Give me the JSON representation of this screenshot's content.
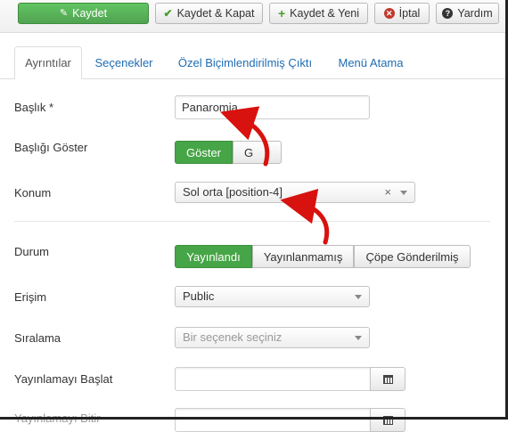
{
  "toolbar": {
    "save": "Kaydet",
    "save_close": "Kaydet & Kapat",
    "save_new": "Kaydet & Yeni",
    "cancel": "İptal",
    "help": "Yardım"
  },
  "tabs": [
    {
      "label": "Ayrıntılar",
      "active": true
    },
    {
      "label": "Seçenekler",
      "active": false
    },
    {
      "label": "Özel Biçimlendirilmiş Çıktı",
      "active": false
    },
    {
      "label": "Menü Atama",
      "active": false
    }
  ],
  "form": {
    "title_label": "Başlık *",
    "title_value": "Panaromia",
    "show_title_label": "Başlığı Göster",
    "show_title_on": "Göster",
    "show_title_off": "G",
    "position_label": "Konum",
    "position_value": "Sol orta [position-4]",
    "position_clear": "×",
    "status_label": "Durum",
    "status_options": [
      "Yayınlandı",
      "Yayınlanmamış",
      "Çöpe Gönderilmiş"
    ],
    "access_label": "Erişim",
    "access_value": "Public",
    "ordering_label": "Sıralama",
    "ordering_placeholder": "Bir seçenek seçiniz",
    "publish_up_label": "Yayınlamayı Başlat",
    "publish_down_label": "Yayınlamayı Bitir"
  },
  "colors": {
    "primary_green": "#51a351",
    "active_green": "#46a546",
    "link_blue": "#1f6db3",
    "arrow_red": "#d8120e"
  },
  "icons": [
    "save-icon",
    "check-icon",
    "plus-icon",
    "cancel-icon",
    "help-icon",
    "calendar-icon",
    "caret-icon"
  ]
}
